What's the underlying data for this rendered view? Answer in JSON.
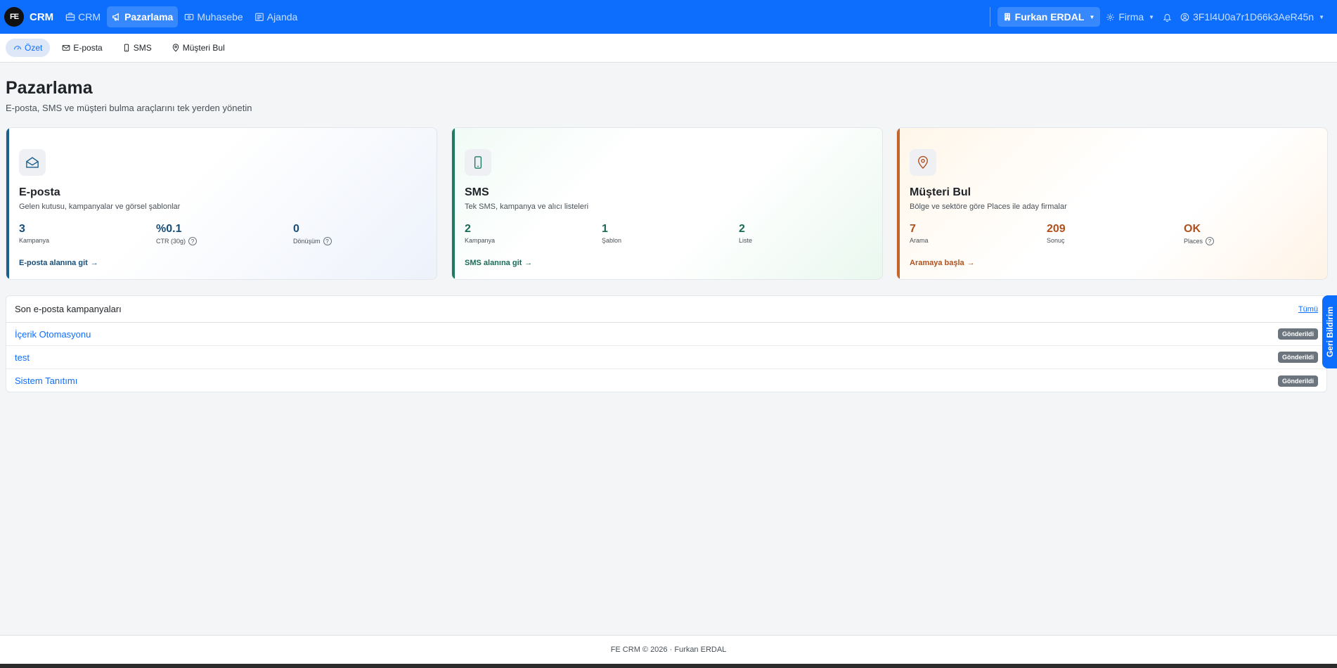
{
  "navbar": {
    "brand_logo": "FE",
    "brand_name": "CRM",
    "links": [
      {
        "label": "CRM",
        "icon": "briefcase-icon"
      },
      {
        "label": "Pazarlama",
        "icon": "megaphone-icon"
      },
      {
        "label": "Muhasebe",
        "icon": "cash-icon"
      },
      {
        "label": "Ajanda",
        "icon": "calendar-icon"
      }
    ],
    "company": "Furkan ERDAL",
    "firma": "Firma",
    "user": "3F1l4U0a7r1D66k3AeR45n"
  },
  "subnav": {
    "items": [
      {
        "label": "Özet",
        "icon": "speedometer-icon"
      },
      {
        "label": "E-posta",
        "icon": "envelope-icon"
      },
      {
        "label": "SMS",
        "icon": "phone-icon"
      },
      {
        "label": "Müşteri Bul",
        "icon": "map-pin-icon"
      }
    ]
  },
  "header": {
    "title": "Pazarlama",
    "subtitle": "E-posta, SMS ve müşteri bulma araçlarını tek yerden yönetin"
  },
  "cards": {
    "email": {
      "title": "E-posta",
      "desc": "Gelen kutusu, kampanyalar ve görsel şablonlar",
      "stats": [
        {
          "value": "3",
          "label": "Kampanya"
        },
        {
          "value": "%0.1",
          "label": "CTR (30g)"
        },
        {
          "value": "0",
          "label": "Dönüşüm"
        }
      ],
      "link": "E-posta alanına git"
    },
    "sms": {
      "title": "SMS",
      "desc": "Tek SMS, kampanya ve alıcı listeleri",
      "stats": [
        {
          "value": "2",
          "label": "Kampanya"
        },
        {
          "value": "1",
          "label": "Şablon"
        },
        {
          "value": "2",
          "label": "Liste"
        }
      ],
      "link": "SMS alanına git"
    },
    "find": {
      "title": "Müşteri Bul",
      "desc": "Bölge ve sektöre göre Places ile aday firmalar",
      "stats": [
        {
          "value": "7",
          "label": "Arama"
        },
        {
          "value": "209",
          "label": "Sonuç"
        },
        {
          "value": "OK",
          "label": "Places"
        }
      ],
      "link": "Aramaya başla"
    }
  },
  "campaigns": {
    "title": "Son e-posta kampanyaları",
    "all_link": "Tümü",
    "rows": [
      {
        "name": "İçerik Otomasyonu",
        "status": "Gönderildi"
      },
      {
        "name": "test",
        "status": "Gönderildi"
      },
      {
        "name": "Sistem Tanıtımı",
        "status": "Gönderildi"
      }
    ]
  },
  "feedback": "Geri Bildirim",
  "footer": {
    "text": "FE CRM © 2026  ·  Furkan ERDAL"
  },
  "colors": {
    "primary": "#0d6efd",
    "email_accent": "#1c5f8d",
    "sms_accent": "#1f7a64",
    "find_accent": "#c4632b",
    "badge": "#6c757d"
  }
}
